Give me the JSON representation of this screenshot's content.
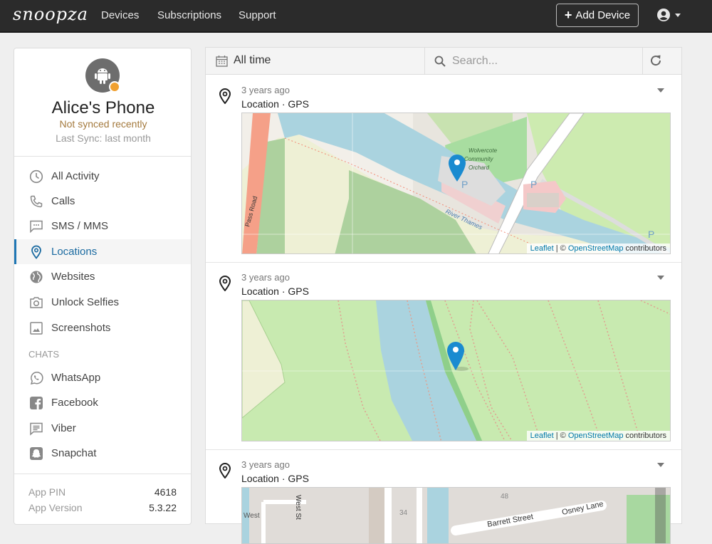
{
  "navbar": {
    "brand": "snoopza",
    "links": [
      "Devices",
      "Subscriptions",
      "Support"
    ],
    "add_device_label": "Add Device",
    "add_device_icon": "plus-icon",
    "user_icon": "user-circle-icon"
  },
  "device": {
    "name": "Alice's Phone",
    "platform_icon": "android-icon",
    "sync_status": "Not synced recently",
    "last_sync": "Last Sync: last month",
    "status_color": "#f0a030"
  },
  "sidebar": {
    "items": [
      {
        "label": "All Activity",
        "icon": "clock-icon"
      },
      {
        "label": "Calls",
        "icon": "phone-icon"
      },
      {
        "label": "SMS / MMS",
        "icon": "message-icon"
      },
      {
        "label": "Locations",
        "icon": "map-pin-icon",
        "active": true
      },
      {
        "label": "Websites",
        "icon": "globe-icon"
      },
      {
        "label": "Unlock Selfies",
        "icon": "camera-icon"
      },
      {
        "label": "Screenshots",
        "icon": "image-icon"
      }
    ],
    "chats_label": "CHATS",
    "chats": [
      {
        "label": "WhatsApp",
        "icon": "whatsapp-icon"
      },
      {
        "label": "Facebook",
        "icon": "facebook-icon"
      },
      {
        "label": "Viber",
        "icon": "viber-icon"
      },
      {
        "label": "Snapchat",
        "icon": "snapchat-icon"
      }
    ],
    "info": [
      {
        "key": "App PIN",
        "value": "4618"
      },
      {
        "key": "App Version",
        "value": "5.3.22"
      }
    ]
  },
  "toolbar": {
    "date_filter": "All time",
    "search_placeholder": "Search...",
    "search_value": ""
  },
  "entries": [
    {
      "time": "3 years ago",
      "type": "Location · GPS",
      "map_labels": [
        "Wolvercote",
        "Community",
        "Orchard",
        "River Thames",
        "Pass Road"
      ]
    },
    {
      "time": "3 years ago",
      "type": "Location · GPS",
      "map_labels": []
    },
    {
      "time": "3 years ago",
      "type": "Location · GPS",
      "map_labels": [
        "West St",
        "Barrett Street",
        "Osney Lane",
        "48",
        "34",
        "West"
      ]
    }
  ],
  "attribution": {
    "leaflet": "Leaflet",
    "sep": " | © ",
    "osm": "OpenStreetMap",
    "suffix": " contributors"
  },
  "colors": {
    "accent": "#1f77b4",
    "navbar_bg": "#2b2b2b",
    "marker": "#1a8bd0",
    "water": "#aad3df",
    "park": "#c8e8b0"
  }
}
